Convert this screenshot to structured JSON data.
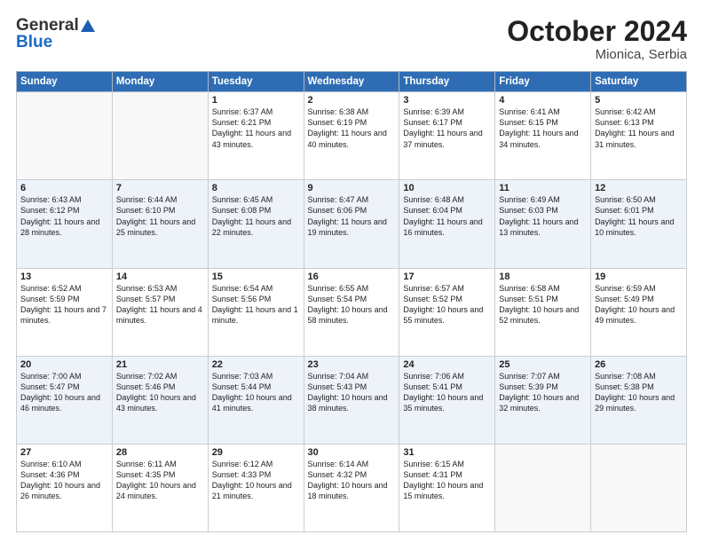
{
  "header": {
    "logo_general": "General",
    "logo_blue": "Blue",
    "month_title": "October 2024",
    "location": "Mionica, Serbia"
  },
  "days_of_week": [
    "Sunday",
    "Monday",
    "Tuesday",
    "Wednesday",
    "Thursday",
    "Friday",
    "Saturday"
  ],
  "weeks": [
    [
      {
        "day": "",
        "info": ""
      },
      {
        "day": "",
        "info": ""
      },
      {
        "day": "1",
        "info": "Sunrise: 6:37 AM\nSunset: 6:21 PM\nDaylight: 11 hours\nand 43 minutes."
      },
      {
        "day": "2",
        "info": "Sunrise: 6:38 AM\nSunset: 6:19 PM\nDaylight: 11 hours\nand 40 minutes."
      },
      {
        "day": "3",
        "info": "Sunrise: 6:39 AM\nSunset: 6:17 PM\nDaylight: 11 hours\nand 37 minutes."
      },
      {
        "day": "4",
        "info": "Sunrise: 6:41 AM\nSunset: 6:15 PM\nDaylight: 11 hours\nand 34 minutes."
      },
      {
        "day": "5",
        "info": "Sunrise: 6:42 AM\nSunset: 6:13 PM\nDaylight: 11 hours\nand 31 minutes."
      }
    ],
    [
      {
        "day": "6",
        "info": "Sunrise: 6:43 AM\nSunset: 6:12 PM\nDaylight: 11 hours\nand 28 minutes."
      },
      {
        "day": "7",
        "info": "Sunrise: 6:44 AM\nSunset: 6:10 PM\nDaylight: 11 hours\nand 25 minutes."
      },
      {
        "day": "8",
        "info": "Sunrise: 6:45 AM\nSunset: 6:08 PM\nDaylight: 11 hours\nand 22 minutes."
      },
      {
        "day": "9",
        "info": "Sunrise: 6:47 AM\nSunset: 6:06 PM\nDaylight: 11 hours\nand 19 minutes."
      },
      {
        "day": "10",
        "info": "Sunrise: 6:48 AM\nSunset: 6:04 PM\nDaylight: 11 hours\nand 16 minutes."
      },
      {
        "day": "11",
        "info": "Sunrise: 6:49 AM\nSunset: 6:03 PM\nDaylight: 11 hours\nand 13 minutes."
      },
      {
        "day": "12",
        "info": "Sunrise: 6:50 AM\nSunset: 6:01 PM\nDaylight: 11 hours\nand 10 minutes."
      }
    ],
    [
      {
        "day": "13",
        "info": "Sunrise: 6:52 AM\nSunset: 5:59 PM\nDaylight: 11 hours\nand 7 minutes."
      },
      {
        "day": "14",
        "info": "Sunrise: 6:53 AM\nSunset: 5:57 PM\nDaylight: 11 hours\nand 4 minutes."
      },
      {
        "day": "15",
        "info": "Sunrise: 6:54 AM\nSunset: 5:56 PM\nDaylight: 11 hours\nand 1 minute."
      },
      {
        "day": "16",
        "info": "Sunrise: 6:55 AM\nSunset: 5:54 PM\nDaylight: 10 hours\nand 58 minutes."
      },
      {
        "day": "17",
        "info": "Sunrise: 6:57 AM\nSunset: 5:52 PM\nDaylight: 10 hours\nand 55 minutes."
      },
      {
        "day": "18",
        "info": "Sunrise: 6:58 AM\nSunset: 5:51 PM\nDaylight: 10 hours\nand 52 minutes."
      },
      {
        "day": "19",
        "info": "Sunrise: 6:59 AM\nSunset: 5:49 PM\nDaylight: 10 hours\nand 49 minutes."
      }
    ],
    [
      {
        "day": "20",
        "info": "Sunrise: 7:00 AM\nSunset: 5:47 PM\nDaylight: 10 hours\nand 46 minutes."
      },
      {
        "day": "21",
        "info": "Sunrise: 7:02 AM\nSunset: 5:46 PM\nDaylight: 10 hours\nand 43 minutes."
      },
      {
        "day": "22",
        "info": "Sunrise: 7:03 AM\nSunset: 5:44 PM\nDaylight: 10 hours\nand 41 minutes."
      },
      {
        "day": "23",
        "info": "Sunrise: 7:04 AM\nSunset: 5:43 PM\nDaylight: 10 hours\nand 38 minutes."
      },
      {
        "day": "24",
        "info": "Sunrise: 7:06 AM\nSunset: 5:41 PM\nDaylight: 10 hours\nand 35 minutes."
      },
      {
        "day": "25",
        "info": "Sunrise: 7:07 AM\nSunset: 5:39 PM\nDaylight: 10 hours\nand 32 minutes."
      },
      {
        "day": "26",
        "info": "Sunrise: 7:08 AM\nSunset: 5:38 PM\nDaylight: 10 hours\nand 29 minutes."
      }
    ],
    [
      {
        "day": "27",
        "info": "Sunrise: 6:10 AM\nSunset: 4:36 PM\nDaylight: 10 hours\nand 26 minutes."
      },
      {
        "day": "28",
        "info": "Sunrise: 6:11 AM\nSunset: 4:35 PM\nDaylight: 10 hours\nand 24 minutes."
      },
      {
        "day": "29",
        "info": "Sunrise: 6:12 AM\nSunset: 4:33 PM\nDaylight: 10 hours\nand 21 minutes."
      },
      {
        "day": "30",
        "info": "Sunrise: 6:14 AM\nSunset: 4:32 PM\nDaylight: 10 hours\nand 18 minutes."
      },
      {
        "day": "31",
        "info": "Sunrise: 6:15 AM\nSunset: 4:31 PM\nDaylight: 10 hours\nand 15 minutes."
      },
      {
        "day": "",
        "info": ""
      },
      {
        "day": "",
        "info": ""
      }
    ]
  ]
}
